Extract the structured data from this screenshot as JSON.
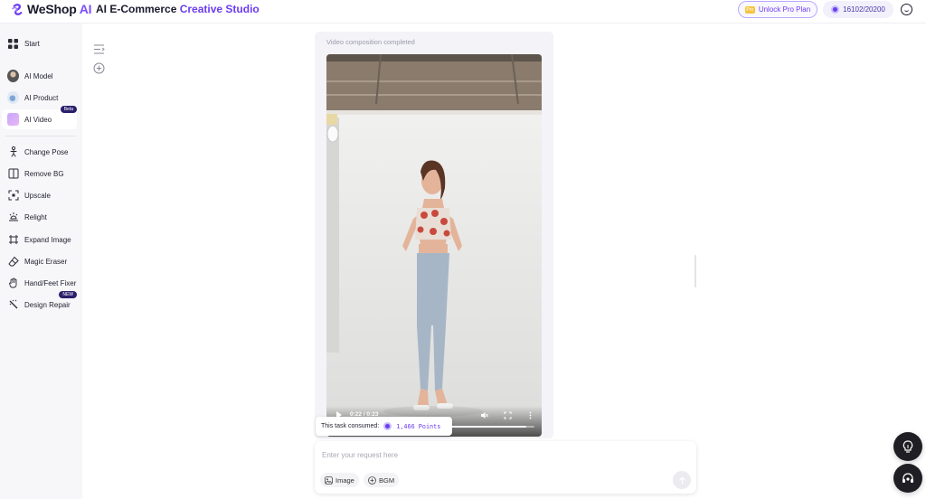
{
  "header": {
    "logo_main": "WeShop",
    "logo_ai": "AI",
    "title_main": "AI E-Commerce",
    "title_accent": "Creative Studio",
    "pro_label": "Unlock Pro Plan",
    "pro_badge": "Pro",
    "points": "16102/20200"
  },
  "sidebar": {
    "start": "Start",
    "ai_model": "AI Model",
    "ai_product": "AI Product",
    "ai_video": "AI Video",
    "ai_video_badge": "Beta",
    "change_pose": "Change Pose",
    "remove_bg": "Remove BG",
    "upscale": "Upscale",
    "relight": "Relight",
    "expand_image": "Expand Image",
    "magic_eraser": "Magic Eraser",
    "hand_feet_fixer": "Hand/Feet Fixer",
    "design_repair": "Design Repair",
    "design_repair_badge": "NEW"
  },
  "canvas": {
    "status": "Video composition completed",
    "time": "0:22 / 0:23",
    "progress": 0.957
  },
  "consumed": {
    "label": "This task consumed:",
    "points": "1,466 Points"
  },
  "input": {
    "placeholder": "Enter your request here",
    "image_chip": "Image",
    "bgm_chip": "BGM"
  },
  "colors": {
    "accent": "#6b3cf0",
    "dark": "#1e1e24"
  }
}
